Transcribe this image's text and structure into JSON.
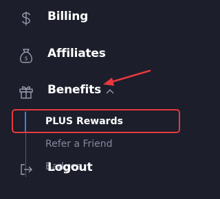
{
  "nav": {
    "billing": {
      "label": "Billing",
      "icon": "dollar-icon"
    },
    "affiliates": {
      "label": "Affiliates",
      "icon": "money-bag-icon"
    },
    "benefits": {
      "label": "Benefits",
      "icon": "gift-icon",
      "expanded": true
    },
    "logout": {
      "label": "Logout",
      "icon": "logout-icon"
    }
  },
  "benefits_submenu": [
    {
      "label": "PLUS Rewards",
      "active": true
    },
    {
      "label": "Refer a Friend",
      "active": false
    },
    {
      "label": "Badges",
      "active": false
    }
  ],
  "annotation": {
    "color": "#e8393e"
  },
  "colors": {
    "background": "#1c1e2b",
    "active_indicator": "#3a80f0",
    "muted_text": "#868a9f"
  }
}
